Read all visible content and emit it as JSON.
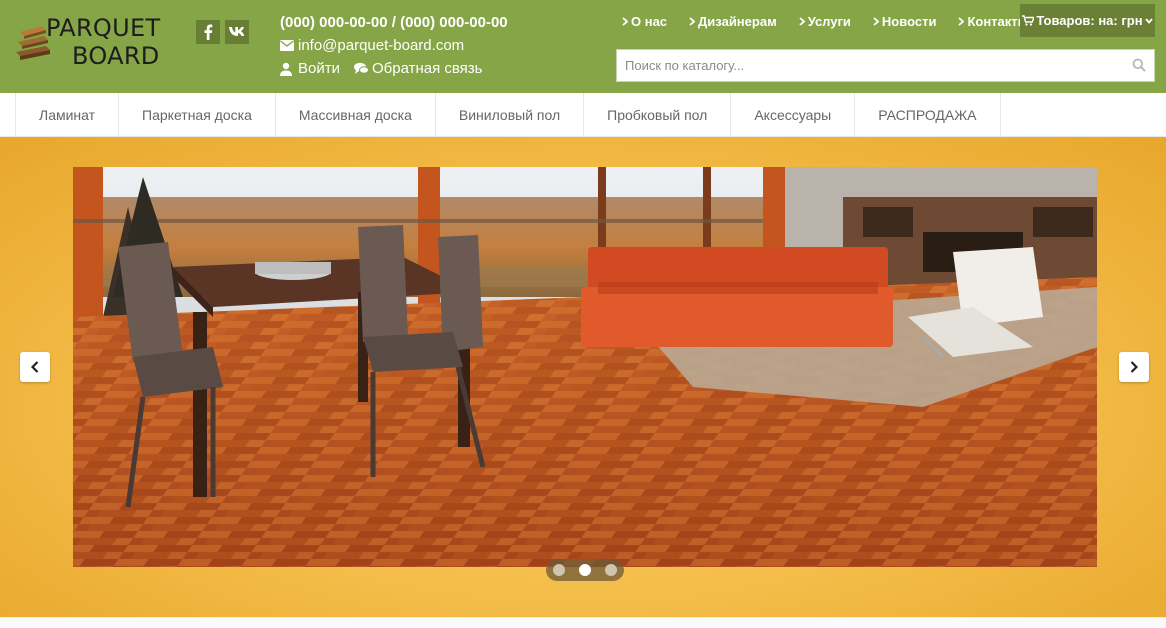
{
  "header": {
    "logo": {
      "line1": "PARQUET",
      "line2": "BOARD"
    },
    "social": [
      {
        "name": "facebook",
        "glyph": "f"
      },
      {
        "name": "vk",
        "glyph": "vk"
      }
    ],
    "contacts": {
      "phones": "(000) 000-00-00 / (000) 000-00-00",
      "email": "info@parquet-board.com",
      "login": "Войти",
      "feedback": "Обратная связь"
    },
    "top_nav": [
      "О нас",
      "Дизайнерам",
      "Услуги",
      "Новости",
      "Контакты"
    ],
    "cart": {
      "label": "Товаров: на: грн"
    },
    "search": {
      "placeholder": "Поиск по каталогу..."
    }
  },
  "categories": [
    "Ламинат",
    "Паркетная доска",
    "Массивная доска",
    "Виниловый пол",
    "Пробковый пол",
    "Аксессуары",
    "РАСПРОДАЖА"
  ],
  "slider": {
    "slides_count": 3,
    "active_index": 1
  },
  "colors": {
    "header_bg": "#86a547",
    "header_dark": "#6a8135",
    "hero_bg": "#f6c04e",
    "cat_text": "#666666"
  },
  "icons": {
    "social_facebook": "facebook-icon",
    "social_vk": "vk-icon",
    "phone": "phone-icon",
    "email": "envelope-icon",
    "login": "user-icon",
    "feedback": "comments-icon",
    "nav_chevron": "chevron-right-icon",
    "cart": "cart-icon",
    "search": "search-icon",
    "prev": "chevron-left-icon",
    "next": "chevron-right-icon"
  }
}
